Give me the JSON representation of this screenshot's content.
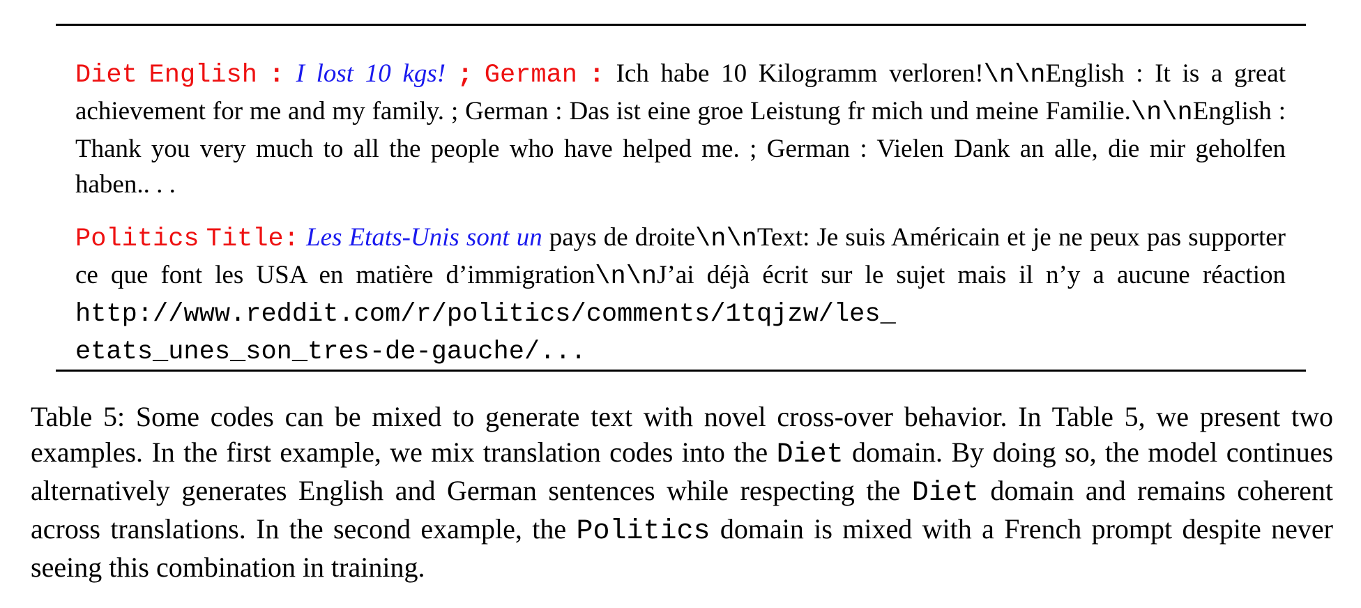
{
  "row1": {
    "code_diet": "Diet",
    "code_english": "English",
    "sep_colon1": ":",
    "prompt": "I lost 10 kgs!",
    "sep_semicolon": ";",
    "code_german": "German",
    "sep_colon2": ":",
    "text_a": "Ich habe 10 Kilogramm verloren!",
    "newline_1": "\\n\\n",
    "text_b": "English : It is a great achievement for me and my family. ; German : Das ist eine groe Leistung fr mich und meine Familie.",
    "newline_2": "\\n\\n",
    "text_c": "English : Thank you very much to all the people who have helped me. ; German : Vielen Dank an alle, die mir geholfen haben.. . ."
  },
  "row2": {
    "code_politics": "Politics",
    "code_title": "Title:",
    "prompt": "Les Etats-Unis sont un",
    "text_a": "pays de droite",
    "newline_1": "\\n\\n",
    "text_b": "Text: Je suis Américain et je ne peux pas supporter ce que font les USA en matière d’immigration",
    "newline_2": "\\n\\n",
    "text_c": "J’ai déjà écrit sur le sujet mais il n’y a aucune réaction",
    "url_part1": "http://www.reddit.com/r/politics/comments/1tqjzw/les_",
    "url_part2": "etats_unes_son_tres-de-gauche/...",
    "url_note": "URL"
  },
  "caption": {
    "part1": "Table 5: Some codes can be mixed to generate text with novel cross-over behavior. In Table 5, we present two examples. In the first example, we mix translation codes into the",
    "code1": "Diet",
    "part2": "domain. By doing so, the model continues alternatively generates English and German sentences while respecting the",
    "code2": "Diet",
    "part3": "domain and remains coherent across translations. In the second example, the",
    "code3": "Politics",
    "part4": "domain is mixed with a French prompt despite never seeing this combination in training."
  },
  "colors": {
    "control_code": "#ee1111",
    "prompt": "#1a1aee",
    "text": "#000000"
  }
}
